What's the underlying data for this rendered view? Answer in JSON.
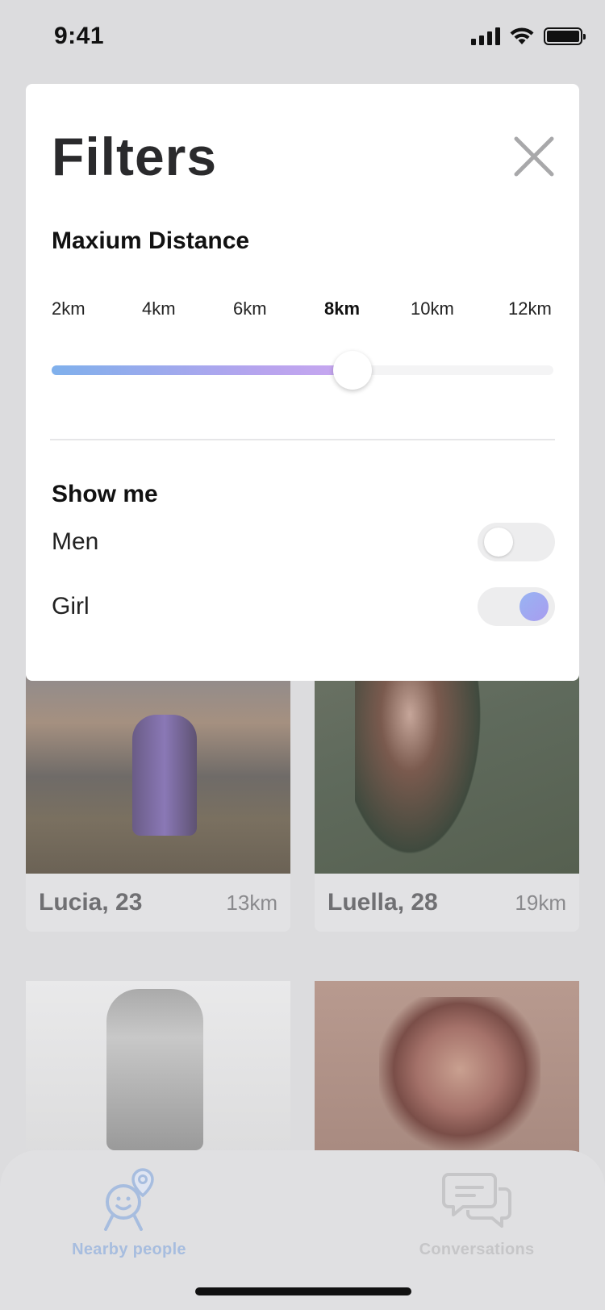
{
  "status_bar": {
    "time": "9:41"
  },
  "filters": {
    "title": "Filters",
    "distance": {
      "title": "Maxium Distance",
      "options": [
        "2km",
        "4km",
        "6km",
        "8km",
        "10km",
        "12km"
      ],
      "selected": "8km",
      "slider_fraction": 0.6
    },
    "show_me": {
      "title": "Show me",
      "options": [
        {
          "label": "Men",
          "on": false
        },
        {
          "label": "Girl",
          "on": true
        }
      ]
    }
  },
  "people": [
    {
      "name": "Lucia, 23",
      "distance": "13km"
    },
    {
      "name": "Luella, 28",
      "distance": "19km"
    }
  ],
  "tabs": {
    "nearby": {
      "label": "Nearby people",
      "icon": "nearby-people-icon"
    },
    "conversations": {
      "label": "Conversations",
      "icon": "chat-bubbles-icon"
    }
  },
  "colors": {
    "accent_start": "#7fb0ec",
    "accent_end": "#c9a7f0",
    "tab_active": "#a7bddf",
    "tab_inactive": "#c6c6c8"
  }
}
